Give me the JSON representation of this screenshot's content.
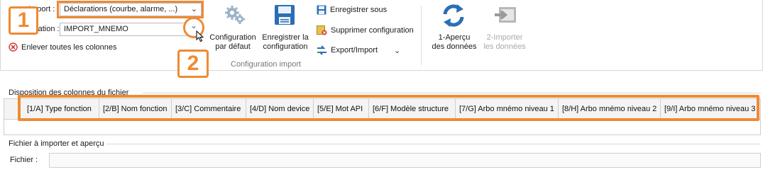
{
  "ribbon": {
    "import_label": "Import :",
    "import_value": "Déclarations (courbe, alarme, ...)",
    "configuration_label": "Configuration :",
    "configuration_value": "IMPORT_MNEMO",
    "remove_columns_label": "Enlever toutes les colonnes",
    "default_config": [
      "Configuration",
      "par défaut"
    ],
    "save_config": [
      "Enregistrer la",
      "configuration"
    ],
    "save_as": "Enregistrer sous",
    "delete_config": "Supprimer configuration",
    "export_import": "Export/Import",
    "group_label": "Configuration import",
    "preview": [
      "1-Aperçu",
      "des données"
    ],
    "import_data": [
      "2-Importer",
      "les données"
    ]
  },
  "callouts": {
    "one": "1",
    "two": "2"
  },
  "columns_section": {
    "title": "Disposition des colonnes du fichier",
    "columns": [
      "[1/A] Type fonction",
      "[2/B] Nom fonction",
      "[3/C] Commentaire",
      "[4/D] Nom device",
      "[5/E] Mot API",
      "[6/F] Modèle structure",
      "[7/G] Arbo mnémo niveau 1",
      "[8/H] Arbo mnémo niveau 2",
      "[9/I] Arbo mnémo niveau 3"
    ]
  },
  "file_section": {
    "title": "Fichier à importer et aperçu",
    "file_label": "Fichier :"
  },
  "colors": {
    "accent_orange": "#ef8a33",
    "icon_blue": "#2a6fb3",
    "remove_red": "#d93a3a",
    "disabled_gray": "#a8a8a8"
  }
}
